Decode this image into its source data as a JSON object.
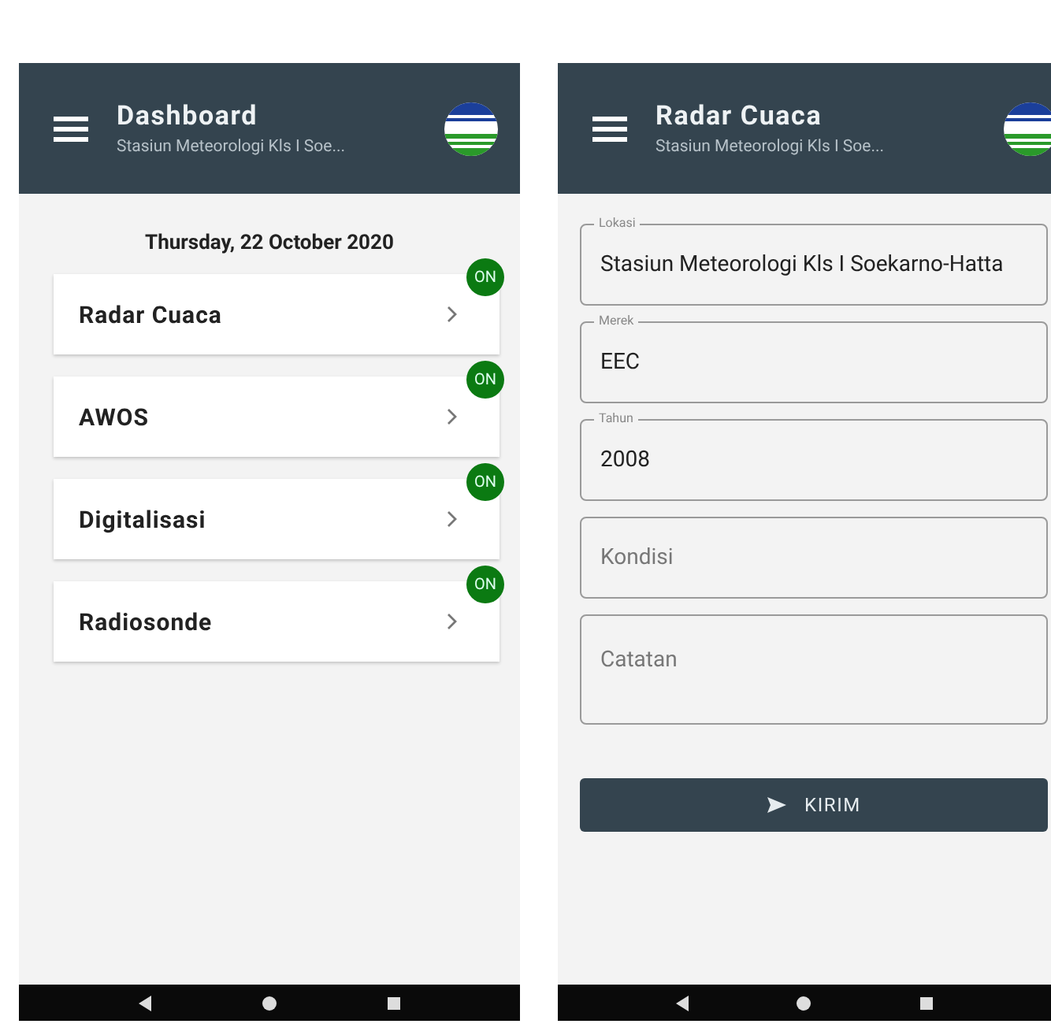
{
  "screens": [
    {
      "app_bar": {
        "title": "Dashboard",
        "subtitle": "Stasiun Meteorologi Kls I Soe..."
      },
      "kind": "dashboard",
      "date": "Thursday, 22 October 2020",
      "items": [
        {
          "label": "Radar Cuaca",
          "status": "ON",
          "color": "#0b7a12"
        },
        {
          "label": "AWOS",
          "status": "ON",
          "color": "#0b7a12"
        },
        {
          "label": "Digitalisasi",
          "status": "ON",
          "color": "#0b7a12"
        },
        {
          "label": "Radiosonde",
          "status": "ON",
          "color": "#0b7a12"
        }
      ]
    },
    {
      "app_bar": {
        "title": "Radar Cuaca",
        "subtitle": "Stasiun Meteorologi Kls I Soe..."
      },
      "kind": "form",
      "fields": [
        {
          "label": "Lokasi",
          "value": "Stasiun Meteorologi Kls I Soekarno-Hatta"
        },
        {
          "label": "Merek",
          "value": "EEC"
        },
        {
          "label": "Tahun",
          "value": "2008"
        },
        {
          "placeholder": "Kondisi"
        },
        {
          "placeholder": "Catatan",
          "multiline": true
        }
      ],
      "submit": {
        "label": "KIRIM"
      }
    }
  ]
}
